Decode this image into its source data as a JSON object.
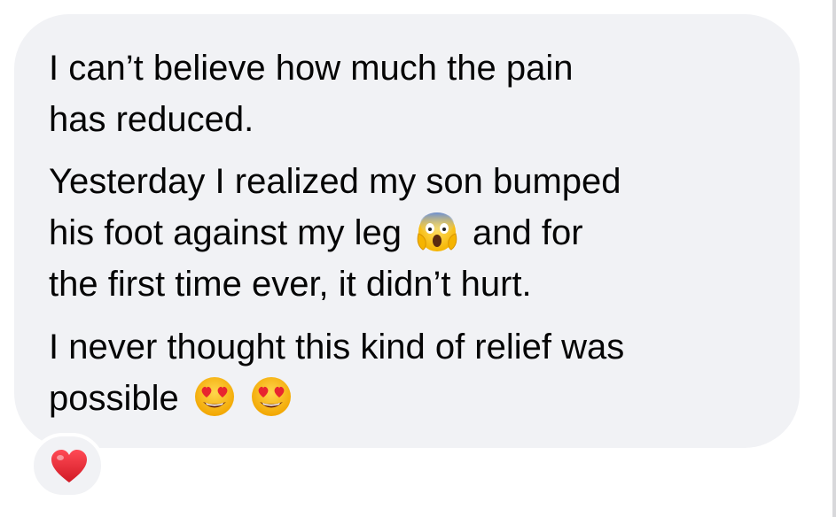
{
  "message": {
    "paragraphs": [
      {
        "lines": [
          "I can’t believe how much the pain",
          "has reduced."
        ]
      },
      {
        "lines": [
          "Yesterday I realized my son bumped",
          "his foot against my leg",
          "and for",
          "the first time ever, it didn’t hurt."
        ]
      },
      {
        "lines": [
          "I never thought this kind of relief was",
          "possible"
        ]
      }
    ],
    "emojis": {
      "scream": "face-screaming-in-fear-icon",
      "heart_eyes": "smiling-face-with-heart-eyes-icon"
    },
    "reaction": {
      "icon": "red-heart-icon",
      "color": "#e8252f"
    },
    "colors": {
      "bubble_bg": "#f1f2f5",
      "text": "#050505"
    }
  }
}
